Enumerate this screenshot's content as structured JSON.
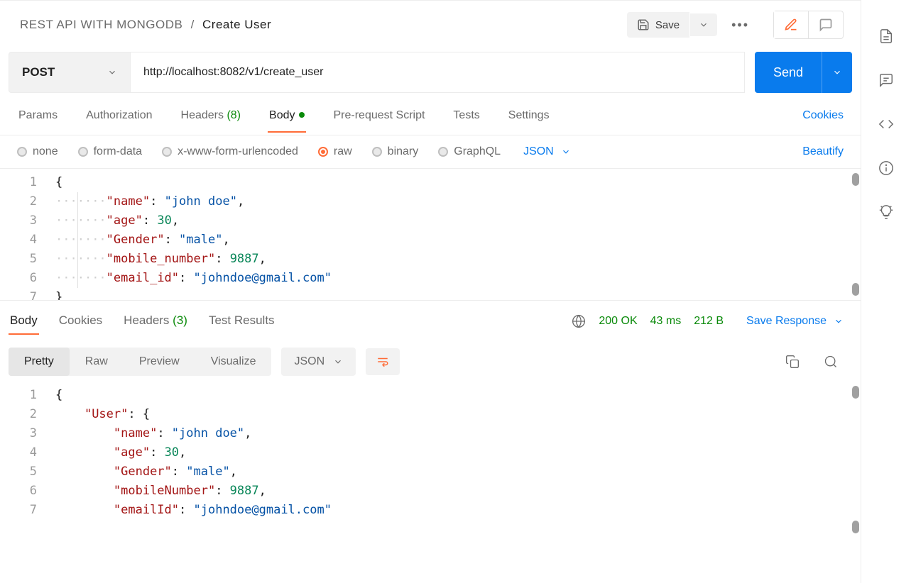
{
  "breadcrumb": {
    "collection": "REST API WITH MONGODB",
    "sep": "/",
    "request": "Create User"
  },
  "header": {
    "save": "Save"
  },
  "request": {
    "method": "POST",
    "url": "http://localhost:8082/v1/create_user",
    "send": "Send"
  },
  "tabs": {
    "params": "Params",
    "authorization": "Authorization",
    "headers": "Headers",
    "headers_count": "(8)",
    "body": "Body",
    "prerequest": "Pre-request Script",
    "tests": "Tests",
    "settings": "Settings",
    "cookies": "Cookies"
  },
  "body_types": {
    "none": "none",
    "form_data": "form-data",
    "xwww": "x-www-form-urlencoded",
    "raw": "raw",
    "binary": "binary",
    "graphql": "GraphQL",
    "json": "JSON",
    "beautify": "Beautify"
  },
  "request_body_lines": [
    {
      "n": "1",
      "tokens": [
        {
          "t": "punc",
          "v": "{"
        }
      ]
    },
    {
      "n": "2",
      "tokens": [
        {
          "t": "indent",
          "v": 1
        },
        {
          "t": "dots",
          "v": "···|····"
        },
        {
          "t": "key",
          "v": "\"name\""
        },
        {
          "t": "punc",
          "v": ": "
        },
        {
          "t": "str",
          "v": "\"john doe\""
        },
        {
          "t": "punc",
          "v": ","
        }
      ]
    },
    {
      "n": "3",
      "tokens": [
        {
          "t": "indent",
          "v": 1
        },
        {
          "t": "dots",
          "v": "···|····"
        },
        {
          "t": "key",
          "v": "\"age\""
        },
        {
          "t": "punc",
          "v": ": "
        },
        {
          "t": "num",
          "v": "30"
        },
        {
          "t": "punc",
          "v": ","
        }
      ]
    },
    {
      "n": "4",
      "tokens": [
        {
          "t": "indent",
          "v": 1
        },
        {
          "t": "dots",
          "v": "···|····"
        },
        {
          "t": "key",
          "v": "\"Gender\""
        },
        {
          "t": "punc",
          "v": ": "
        },
        {
          "t": "str",
          "v": "\"male\""
        },
        {
          "t": "punc",
          "v": ","
        }
      ]
    },
    {
      "n": "5",
      "tokens": [
        {
          "t": "indent",
          "v": 1
        },
        {
          "t": "dots",
          "v": "···|····"
        },
        {
          "t": "key",
          "v": "\"mobile_number\""
        },
        {
          "t": "punc",
          "v": ": "
        },
        {
          "t": "num",
          "v": "9887"
        },
        {
          "t": "punc",
          "v": ","
        }
      ]
    },
    {
      "n": "6",
      "tokens": [
        {
          "t": "indent",
          "v": 1
        },
        {
          "t": "dots",
          "v": "···|····"
        },
        {
          "t": "key",
          "v": "\"email_id\""
        },
        {
          "t": "punc",
          "v": ": "
        },
        {
          "t": "str",
          "v": "\"johndoe@gmail.com\""
        }
      ]
    },
    {
      "n": "7",
      "tokens": [
        {
          "t": "punc",
          "v": "}"
        }
      ]
    }
  ],
  "response": {
    "tabs": {
      "body": "Body",
      "cookies": "Cookies",
      "headers": "Headers",
      "headers_count": "(3)",
      "test_results": "Test Results"
    },
    "status": "200 OK",
    "time": "43 ms",
    "size": "212 B",
    "save": "Save Response",
    "views": {
      "pretty": "Pretty",
      "raw": "Raw",
      "preview": "Preview",
      "visualize": "Visualize",
      "json": "JSON"
    }
  },
  "response_body_lines": [
    {
      "n": "1",
      "tokens": [
        {
          "t": "punc",
          "v": "{"
        }
      ]
    },
    {
      "n": "2",
      "tokens": [
        {
          "t": "pad",
          "v": "    "
        },
        {
          "t": "key",
          "v": "\"User\""
        },
        {
          "t": "punc",
          "v": ": {"
        }
      ]
    },
    {
      "n": "3",
      "tokens": [
        {
          "t": "pad",
          "v": "        "
        },
        {
          "t": "key",
          "v": "\"name\""
        },
        {
          "t": "punc",
          "v": ": "
        },
        {
          "t": "str",
          "v": "\"john doe\""
        },
        {
          "t": "punc",
          "v": ","
        }
      ]
    },
    {
      "n": "4",
      "tokens": [
        {
          "t": "pad",
          "v": "        "
        },
        {
          "t": "key",
          "v": "\"age\""
        },
        {
          "t": "punc",
          "v": ": "
        },
        {
          "t": "num",
          "v": "30"
        },
        {
          "t": "punc",
          "v": ","
        }
      ]
    },
    {
      "n": "5",
      "tokens": [
        {
          "t": "pad",
          "v": "        "
        },
        {
          "t": "key",
          "v": "\"Gender\""
        },
        {
          "t": "punc",
          "v": ": "
        },
        {
          "t": "str",
          "v": "\"male\""
        },
        {
          "t": "punc",
          "v": ","
        }
      ]
    },
    {
      "n": "6",
      "tokens": [
        {
          "t": "pad",
          "v": "        "
        },
        {
          "t": "key",
          "v": "\"mobileNumber\""
        },
        {
          "t": "punc",
          "v": ": "
        },
        {
          "t": "num",
          "v": "9887"
        },
        {
          "t": "punc",
          "v": ","
        }
      ]
    },
    {
      "n": "7",
      "tokens": [
        {
          "t": "pad",
          "v": "        "
        },
        {
          "t": "key",
          "v": "\"emailId\""
        },
        {
          "t": "punc",
          "v": ": "
        },
        {
          "t": "str",
          "v": "\"johndoe@gmail.com\""
        }
      ]
    }
  ]
}
